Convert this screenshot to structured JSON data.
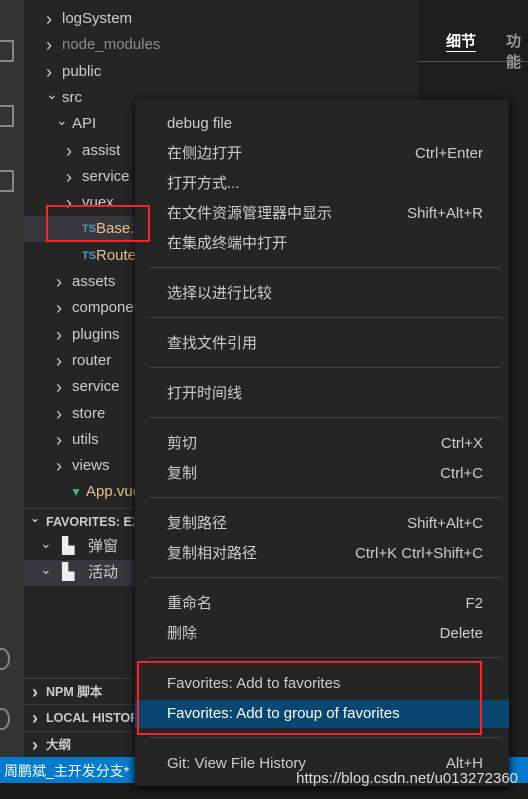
{
  "tree": [
    {
      "label": "logSystem",
      "type": "folder",
      "open": false,
      "level": 0
    },
    {
      "label": "node_modules",
      "type": "folder",
      "open": false,
      "level": 0,
      "dim": true
    },
    {
      "label": "public",
      "type": "folder",
      "open": false,
      "level": 0
    },
    {
      "label": "src",
      "type": "folder",
      "open": true,
      "level": 0
    },
    {
      "label": "API",
      "type": "folder",
      "open": true,
      "level": 1
    },
    {
      "label": "assist",
      "type": "folder",
      "open": false,
      "level": 2
    },
    {
      "label": "service",
      "type": "folder",
      "open": false,
      "level": 2
    },
    {
      "label": "vuex",
      "type": "folder",
      "open": false,
      "level": 2
    },
    {
      "label": "Base.ts",
      "type": "ts",
      "level": 2,
      "selected": true
    },
    {
      "label": "Router.ts",
      "type": "ts",
      "level": 2
    },
    {
      "label": "assets",
      "type": "folder",
      "open": false,
      "level": 1
    },
    {
      "label": "components",
      "type": "folder",
      "open": false,
      "level": 1
    },
    {
      "label": "plugins",
      "type": "folder",
      "open": false,
      "level": 1
    },
    {
      "label": "router",
      "type": "folder",
      "open": false,
      "level": 1
    },
    {
      "label": "service",
      "type": "folder",
      "open": false,
      "level": 1
    },
    {
      "label": "store",
      "type": "folder",
      "open": false,
      "level": 1
    },
    {
      "label": "utils",
      "type": "folder",
      "open": false,
      "level": 1
    },
    {
      "label": "views",
      "type": "folder",
      "open": false,
      "level": 1
    },
    {
      "label": "App.vue",
      "type": "vue",
      "level": 1
    }
  ],
  "ts_badge": "TS",
  "favorites": {
    "header": "FAVORITES: EXPLORER",
    "groups": [
      "弹窗",
      "活动"
    ]
  },
  "panels": [
    "NPM 脚本",
    "LOCAL HISTORY",
    "大纲"
  ],
  "editor_tabs": [
    "细节",
    "功能"
  ],
  "menu": [
    {
      "label": "debug file",
      "key": ""
    },
    {
      "label": "在侧边打开",
      "key": "Ctrl+Enter"
    },
    {
      "label": "打开方式...",
      "key": ""
    },
    {
      "label": "在文件资源管理器中显示",
      "key": "Shift+Alt+R"
    },
    {
      "label": "在集成终端中打开",
      "key": ""
    },
    {
      "sep": true
    },
    {
      "label": "选择以进行比较",
      "key": ""
    },
    {
      "sep": true
    },
    {
      "label": "查找文件引用",
      "key": ""
    },
    {
      "sep": true
    },
    {
      "label": "打开时间线",
      "key": ""
    },
    {
      "sep": true
    },
    {
      "label": "剪切",
      "key": "Ctrl+X"
    },
    {
      "label": "复制",
      "key": "Ctrl+C"
    },
    {
      "sep": true
    },
    {
      "label": "复制路径",
      "key": "Shift+Alt+C"
    },
    {
      "label": "复制相对路径",
      "key": "Ctrl+K Ctrl+Shift+C"
    },
    {
      "sep": true
    },
    {
      "label": "重命名",
      "key": "F2"
    },
    {
      "label": "删除",
      "key": "Delete"
    },
    {
      "sep": true
    },
    {
      "label": "Favorites: Add to favorites",
      "key": ""
    },
    {
      "label": "Favorites: Add to group of favorites",
      "key": "",
      "highlighted": true
    },
    {
      "sep": true
    },
    {
      "label": "Git: View File History",
      "key": "Alt+H"
    }
  ],
  "status": {
    "branch": "周鹏斌_主开发分支*"
  },
  "watermark": "https://blog.csdn.net/u013272360",
  "colors": {
    "highlight": "#094771",
    "status": "#007acc",
    "annotation": "#ff2222"
  }
}
